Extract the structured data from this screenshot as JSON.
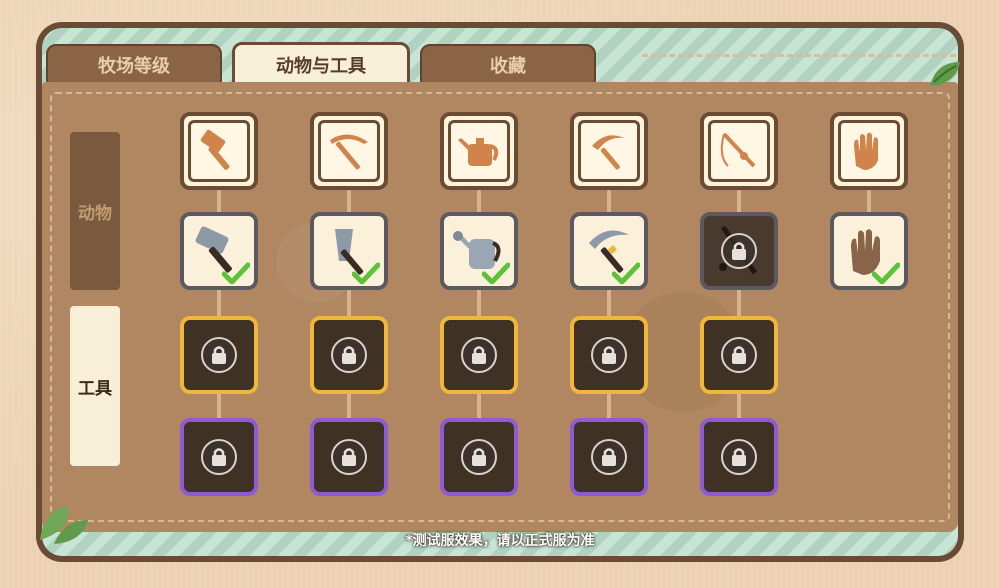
{
  "tabs": [
    {
      "label": "牧场等级",
      "active": false
    },
    {
      "label": "动物与工具",
      "active": true
    },
    {
      "label": "收藏",
      "active": false
    }
  ],
  "sidebar": {
    "animals_label": "动物",
    "tools_label": "工具",
    "active": "tools"
  },
  "columns": [
    {
      "category": "hammer-icon",
      "tiers": [
        "owned",
        "gold-locked",
        "purple-locked"
      ]
    },
    {
      "category": "pickaxe-icon",
      "tiers": [
        "owned",
        "gold-locked",
        "purple-locked"
      ]
    },
    {
      "category": "watering-can-icon",
      "tiers": [
        "owned",
        "gold-locked",
        "purple-locked"
      ]
    },
    {
      "category": "sickle-icon",
      "tiers": [
        "owned",
        "gold-locked",
        "purple-locked"
      ]
    },
    {
      "category": "fishing-rod-icon",
      "tiers": [
        "locked",
        "gold-locked",
        "purple-locked"
      ]
    },
    {
      "category": "gloves-icon",
      "tiers": [
        "owned"
      ]
    }
  ],
  "footer": {
    "note": "*测试服效果，请以正式服为准"
  },
  "colors": {
    "panel": "#b08760",
    "frame": "#6a4c34",
    "gold_border": "#f0b73a",
    "purple_border": "#8f5ad6",
    "gray_border": "#5c5a60",
    "check_green": "#5cc23a"
  }
}
